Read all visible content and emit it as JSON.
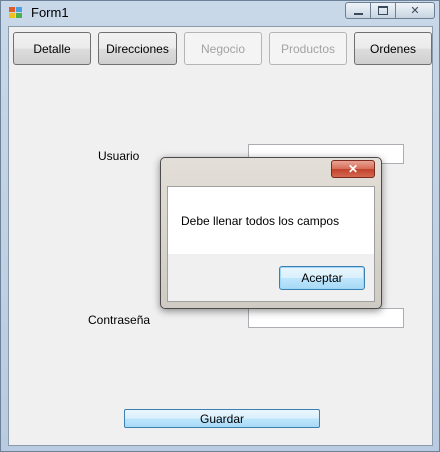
{
  "window": {
    "title": "Form1",
    "buttons": {
      "minimize": "▭",
      "maximize": "◻",
      "close": "✕"
    }
  },
  "toolbar": {
    "items": [
      {
        "label": "Detalle",
        "enabled": true
      },
      {
        "label": "Direcciones",
        "enabled": true
      },
      {
        "label": "Negocio",
        "enabled": false
      },
      {
        "label": "Productos",
        "enabled": false
      },
      {
        "label": "Ordenes",
        "enabled": true
      }
    ]
  },
  "form": {
    "user_label": "Usuario",
    "user_value": "",
    "password_label": "Contraseña",
    "password_value": "",
    "save_label": "Guardar"
  },
  "dialog": {
    "close_glyph": "✕",
    "message": "Debe llenar todos los campos",
    "accept_label": "Aceptar"
  }
}
